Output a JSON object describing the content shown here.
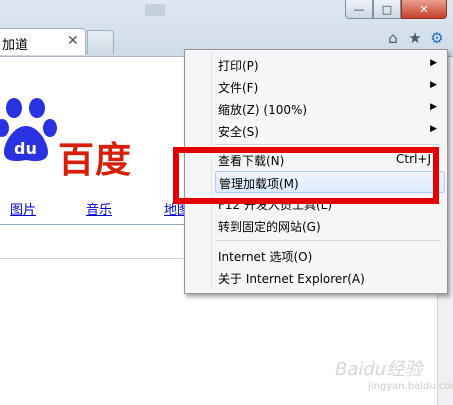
{
  "window": {
    "minimize_label": "—",
    "maximize_label": "□",
    "close_label": "✕"
  },
  "tab": {
    "label": "加道",
    "close_glyph": "✕"
  },
  "toolbar_icons": {
    "home": "⌂",
    "favorites": "★",
    "tools": "⚙"
  },
  "page": {
    "logo_text": "百度",
    "logo_badge_text": "du",
    "nav": [
      "图片",
      "音乐",
      "地图"
    ]
  },
  "menu": {
    "items": [
      {
        "label": "打印(P)",
        "has_submenu": true
      },
      {
        "label": "文件(F)",
        "has_submenu": true
      },
      {
        "label": "缩放(Z) (100%)",
        "has_submenu": true
      },
      {
        "label": "安全(S)",
        "has_submenu": true
      },
      {
        "label": "查看下载(N)",
        "shortcut": "Ctrl+J"
      },
      {
        "label": "管理加载项(M)",
        "highlighted": true
      },
      {
        "label": "F12 开发人员工具(L)"
      },
      {
        "label": "转到固定的网站(G)"
      },
      {
        "label": "Internet 选项(O)"
      },
      {
        "label": "关于 Internet Explorer(A)"
      }
    ],
    "arrow_glyph": "▶"
  },
  "watermark": {
    "text": "Baidu经验",
    "sub": "jingyan.baidu.com"
  },
  "colors": {
    "highlight_box": "#e30000",
    "baidu_red": "#d81e06",
    "baidu_blue": "#2932e1",
    "link": "#0000cc"
  }
}
